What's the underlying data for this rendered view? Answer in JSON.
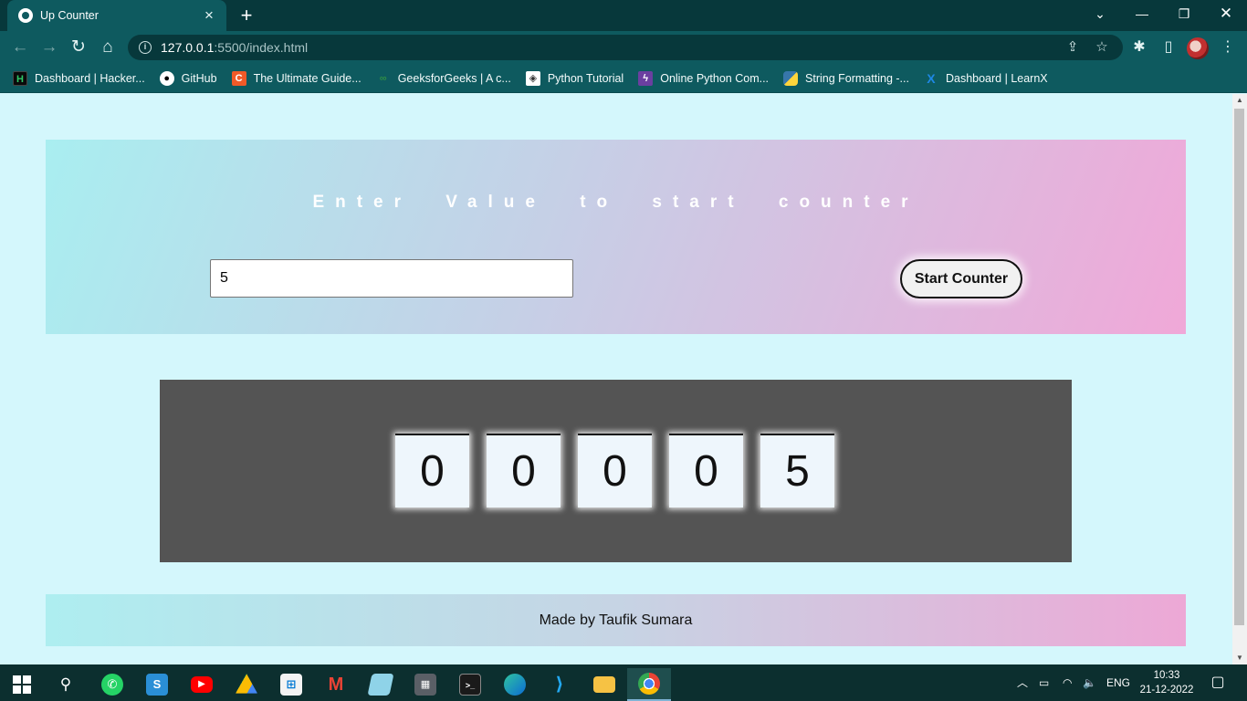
{
  "browser": {
    "tab_title": "Up Counter",
    "url_host": "127.0.0.1",
    "url_path": ":5500/index.html",
    "bookmarks": [
      {
        "label": "Dashboard | Hacker...",
        "icon": "hackerrank-icon",
        "color": "#0a0a0a"
      },
      {
        "label": "GitHub",
        "icon": "github-icon",
        "color": "#ffffff"
      },
      {
        "label": "The Ultimate Guide...",
        "icon": "codecademy-icon",
        "color": "#f05a28"
      },
      {
        "label": "GeeksforGeeks | A c...",
        "icon": "geeksforgeeks-icon",
        "color": "#2f8d46"
      },
      {
        "label": "Python Tutorial",
        "icon": "python-tutorial-icon",
        "color": "#ffffff"
      },
      {
        "label": "Online Python Com...",
        "icon": "replit-icon",
        "color": "#6b3fa0"
      },
      {
        "label": "String Formatting -...",
        "icon": "python-icon",
        "color": "#3776ab"
      },
      {
        "label": "Dashboard | LearnX",
        "icon": "learnx-icon",
        "color": "#1e88e5"
      }
    ]
  },
  "page": {
    "heading": "Enter Value to start counter",
    "input_value": "5",
    "button_label": "Start Counter",
    "digits": [
      "0",
      "0",
      "0",
      "0",
      "5"
    ],
    "footer": "Made by Taufik Sumara"
  },
  "taskbar": {
    "apps": [
      "start-icon",
      "search-icon",
      "whatsapp-icon",
      "simplenote-icon",
      "youtube-icon",
      "google-drive-icon",
      "microsoft-store-icon",
      "gmail-icon",
      "notepad-icon",
      "calculator-icon",
      "terminal-icon",
      "edge-icon",
      "vscode-icon",
      "file-explorer-icon",
      "chrome-icon"
    ],
    "language": "ENG",
    "time": "10:33",
    "date": "21-12-2022"
  },
  "colors": {
    "page_bg": "#d4f7fc",
    "counter_panel": "#545454",
    "chrome_bg": "#0e5a5f"
  }
}
